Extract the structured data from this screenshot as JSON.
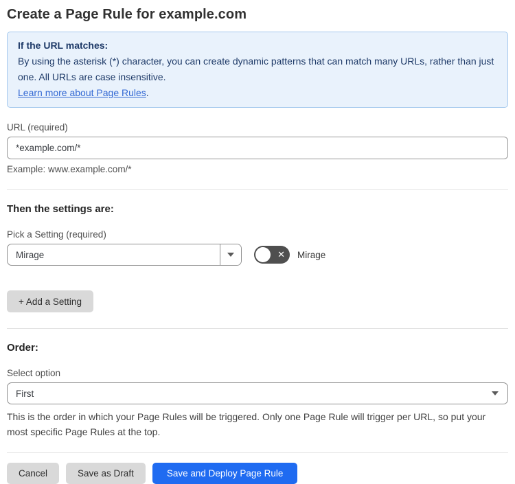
{
  "page": {
    "title": "Create a Page Rule for example.com"
  },
  "info_box": {
    "heading": "If the URL matches:",
    "body": "By using the asterisk (*) character, you can create dynamic patterns that can match many URLs, rather than just one. All URLs are case insensitive.",
    "link_label": "Learn more about Page Rules",
    "link_suffix": "."
  },
  "url_field": {
    "label": "URL (required)",
    "value": "*example.com/*",
    "example": "Example: www.example.com/*"
  },
  "settings_section": {
    "heading": "Then the settings are:",
    "picker_label": "Pick a Setting (required)",
    "picker_value": "Mirage",
    "toggle": {
      "label": "Mirage",
      "state": "off",
      "icon_glyph": "✕"
    },
    "add_button_label": "+ Add a Setting"
  },
  "order_section": {
    "heading": "Order:",
    "select_label": "Select option",
    "select_value": "First",
    "help_text": "This is the order in which your Page Rules will be triggered. Only one Page Rule will trigger per URL, so put your most specific Page Rules at the top."
  },
  "footer": {
    "cancel_label": "Cancel",
    "save_draft_label": "Save as Draft",
    "deploy_label": "Save and Deploy Page Rule"
  },
  "colors": {
    "info_bg": "#e9f2fc",
    "info_border": "#a5c9ee",
    "info_text": "#1e3a68",
    "link": "#3268d3",
    "primary_button": "#1f6bf1",
    "secondary_button": "#d9d9d9",
    "toggle_off_bg": "#4f4f4f"
  }
}
